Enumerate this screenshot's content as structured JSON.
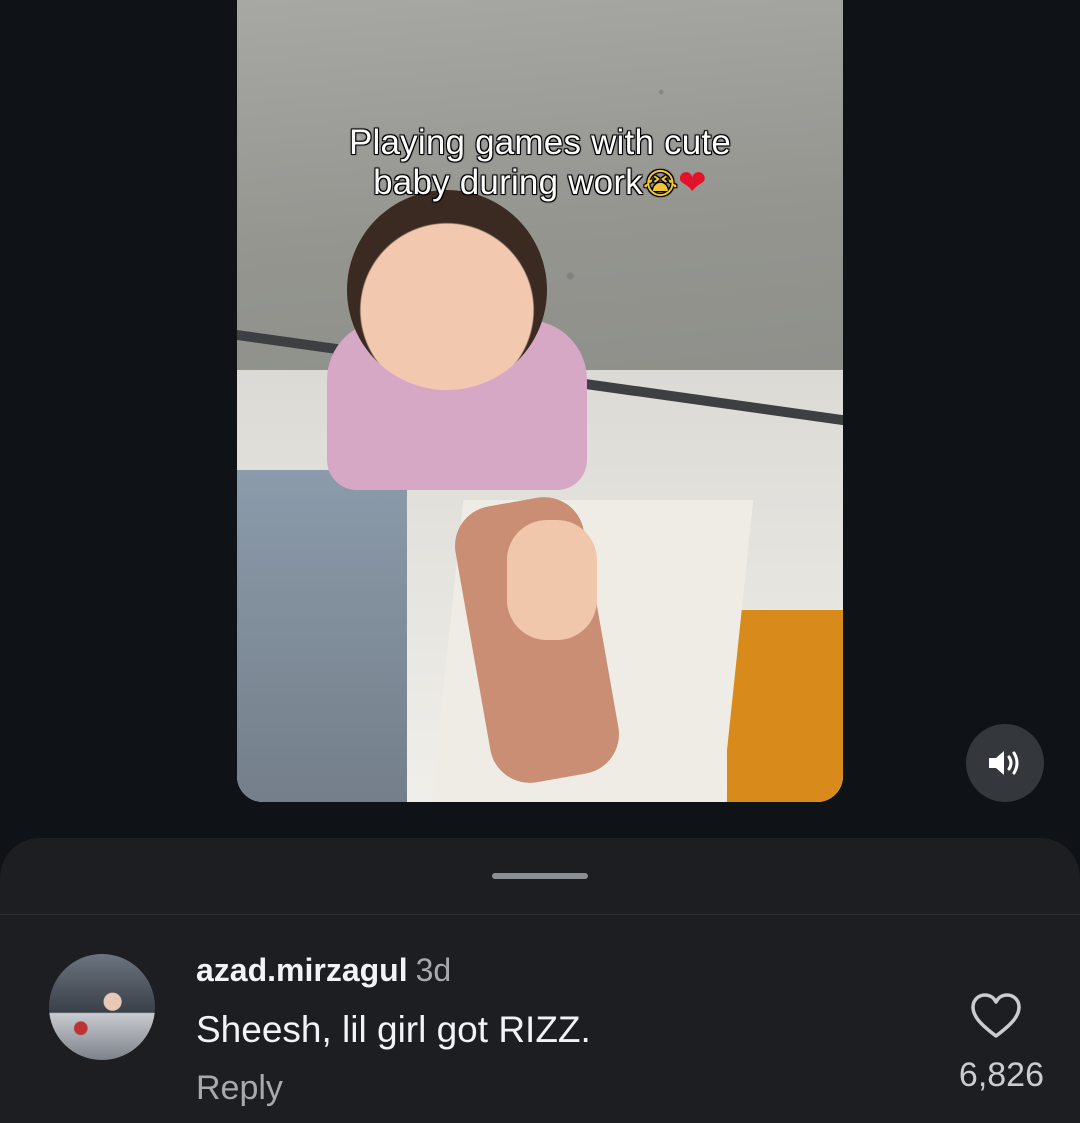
{
  "video": {
    "caption_line1": "Playing games with cute",
    "caption_line2": "baby during work",
    "caption_emoji": "😭",
    "caption_heart": "❤"
  },
  "volume": {
    "icon": "speaker-on-icon"
  },
  "comment": {
    "username": "azad.mirzagul",
    "time": "3d",
    "text": "Sheesh, lil girl got RIZZ.",
    "reply_label": "Reply",
    "like_count": "6,826",
    "like_icon": "heart-outline-icon"
  },
  "colors": {
    "background": "#0f1216",
    "sheet": "#1c1e21",
    "primary_text": "#f2f3f5",
    "secondary_text": "#a6a9ad"
  }
}
